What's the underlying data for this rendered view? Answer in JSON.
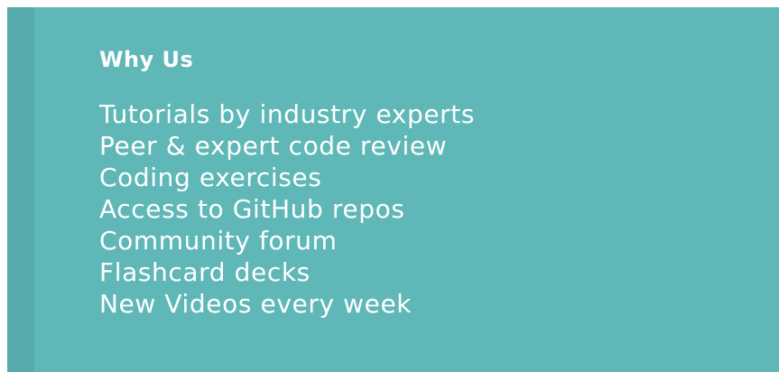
{
  "panel": {
    "background_color": "#5fb8b7",
    "accent_color": "#56acab",
    "text_color": "#ffffff"
  },
  "why_us": {
    "heading": "Why Us",
    "features": [
      "Tutorials by industry experts",
      "Peer & expert code review",
      "Coding exercises",
      "Access to GitHub repos",
      "Community forum",
      "Flashcard decks",
      "New Videos every week"
    ]
  }
}
